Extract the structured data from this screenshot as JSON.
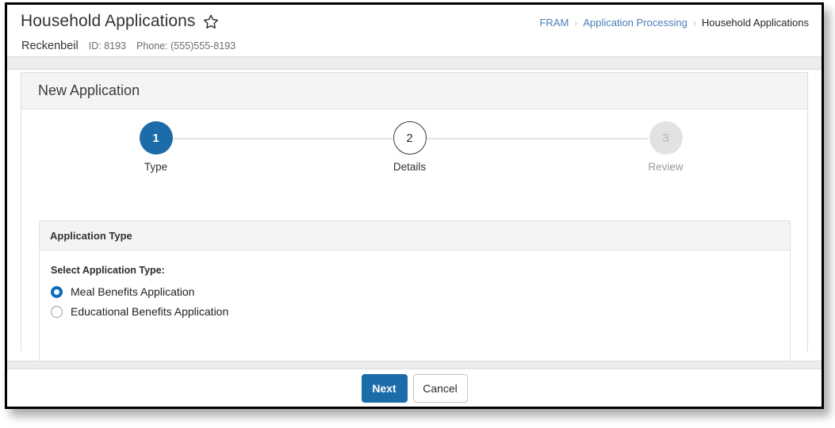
{
  "header": {
    "title": "Household Applications",
    "favorite_icon": "star-icon",
    "person_name": "Reckenbeil",
    "person_id": "ID: 8193",
    "person_phone": "Phone: (555)555-8193"
  },
  "breadcrumb": {
    "items": [
      {
        "label": "FRAM",
        "type": "link"
      },
      {
        "label": "Application Processing",
        "type": "link"
      },
      {
        "label": "Household Applications",
        "type": "current"
      }
    ],
    "separator": "›"
  },
  "card": {
    "title": "New Application"
  },
  "stepper": {
    "steps": [
      {
        "number": "1",
        "label": "Type",
        "state": "active"
      },
      {
        "number": "2",
        "label": "Details",
        "state": "upcoming"
      },
      {
        "number": "3",
        "label": "Review",
        "state": "disabled"
      }
    ]
  },
  "panel": {
    "title": "Application Type",
    "field_label": "Select Application Type:",
    "options": [
      {
        "label": "Meal Benefits Application",
        "selected": true
      },
      {
        "label": "Educational Benefits Application",
        "selected": false
      }
    ]
  },
  "footer": {
    "next_label": "Next",
    "cancel_label": "Cancel"
  },
  "colors": {
    "accent_blue": "#1b6ca8",
    "link_blue": "#4a7ebb",
    "radio_blue": "#0b6cbf",
    "band_gray": "#ececec",
    "panel_header_gray": "#f4f4f4",
    "disabled_gray": "#e2e2e2"
  }
}
